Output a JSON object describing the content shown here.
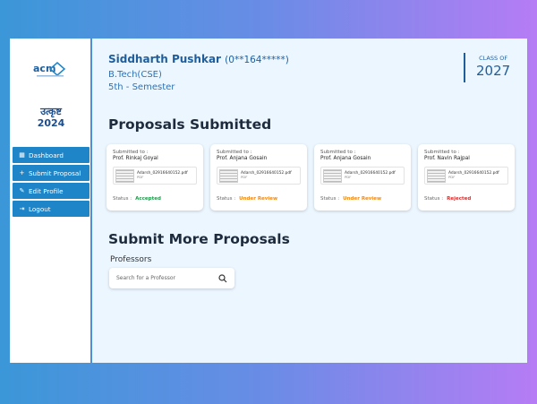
{
  "sidebar": {
    "brand_hindi": "उत्कृष्ट",
    "brand_year": "2024",
    "items": [
      {
        "label": "Dashboard",
        "icon": "dashboard-icon"
      },
      {
        "label": "Submit Proposal",
        "icon": "plus-icon"
      },
      {
        "label": "Edit Profile",
        "icon": "edit-icon"
      },
      {
        "label": "Logout",
        "icon": "logout-icon"
      }
    ]
  },
  "profile": {
    "name": "Siddharth Pushkar",
    "roll": "(0**164*****)",
    "degree": "B.Tech(CSE)",
    "semester": "5th - Semester",
    "class_label": "CLASS OF",
    "class_year": "2027"
  },
  "proposals": {
    "heading": "Proposals Submitted",
    "submitted_to_label": "Submitted to :",
    "status_label": "Status :",
    "items": [
      {
        "professor": "Prof. Rinkaj Goyal",
        "file": "Adarsh_02916640152.pdf",
        "filetype": "PDF",
        "status": "Accepted",
        "status_color": "#1f9a4a"
      },
      {
        "professor": "Prof. Anjana Gosain",
        "file": "Adarsh_02916640152.pdf",
        "filetype": "PDF",
        "status": "Under Review",
        "status_color": "#f08a1c"
      },
      {
        "professor": "Prof. Anjana Gosain",
        "file": "Adarsh_02916640152.pdf",
        "filetype": "PDF",
        "status": "Under Review",
        "status_color": "#f08a1c"
      },
      {
        "professor": "Prof. Navin Rajpal",
        "file": "Adarsh_02916640152.pdf",
        "filetype": "PDF",
        "status": "Rejected",
        "status_color": "#e02b2b"
      }
    ]
  },
  "submit_more": {
    "heading": "Submit More Proposals",
    "professors_label": "Professors",
    "search_placeholder": "Search for a Professor"
  },
  "colors": {
    "accent": "#1d85c8",
    "brand": "#1f5e9b"
  }
}
